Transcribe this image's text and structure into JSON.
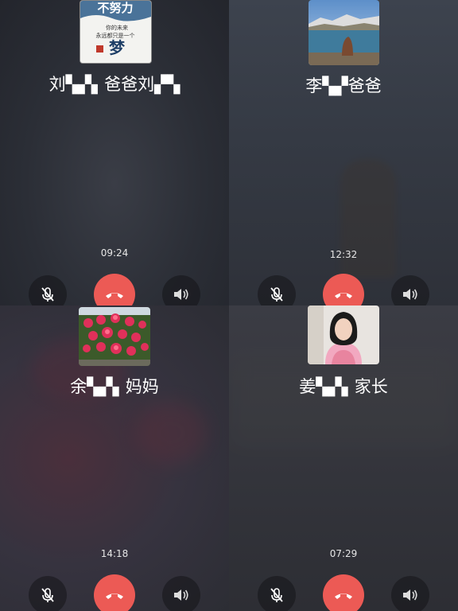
{
  "calls": [
    {
      "avatar_text": [
        "不努力",
        "你的未来",
        "永远都只是一个",
        "梦"
      ],
      "name": "刘▚▞▖爸爸刘▞▚",
      "duration": "09:24",
      "icons": {
        "mute": "mic-off-icon",
        "hangup": "phone-hangup-icon",
        "speaker": "speaker-icon"
      }
    },
    {
      "avatar_text": [],
      "name": "李▚▞爸爸",
      "duration": "12:32",
      "icons": {
        "mute": "mic-off-icon",
        "hangup": "phone-hangup-icon",
        "speaker": "speaker-icon"
      }
    },
    {
      "avatar_text": [],
      "name": "余▚▞▖妈妈",
      "duration": "14:18",
      "icons": {
        "mute": "mic-off-icon",
        "hangup": "phone-hangup-icon",
        "speaker": "speaker-icon"
      }
    },
    {
      "avatar_text": [],
      "name": "姜▚▞▖家长",
      "duration": "07:29",
      "icons": {
        "mute": "mic-off-icon",
        "hangup": "phone-hangup-icon",
        "speaker": "speaker-icon"
      }
    }
  ],
  "colors": {
    "hangup": "#ec5a55",
    "control_bg": "#1a1a1e"
  }
}
